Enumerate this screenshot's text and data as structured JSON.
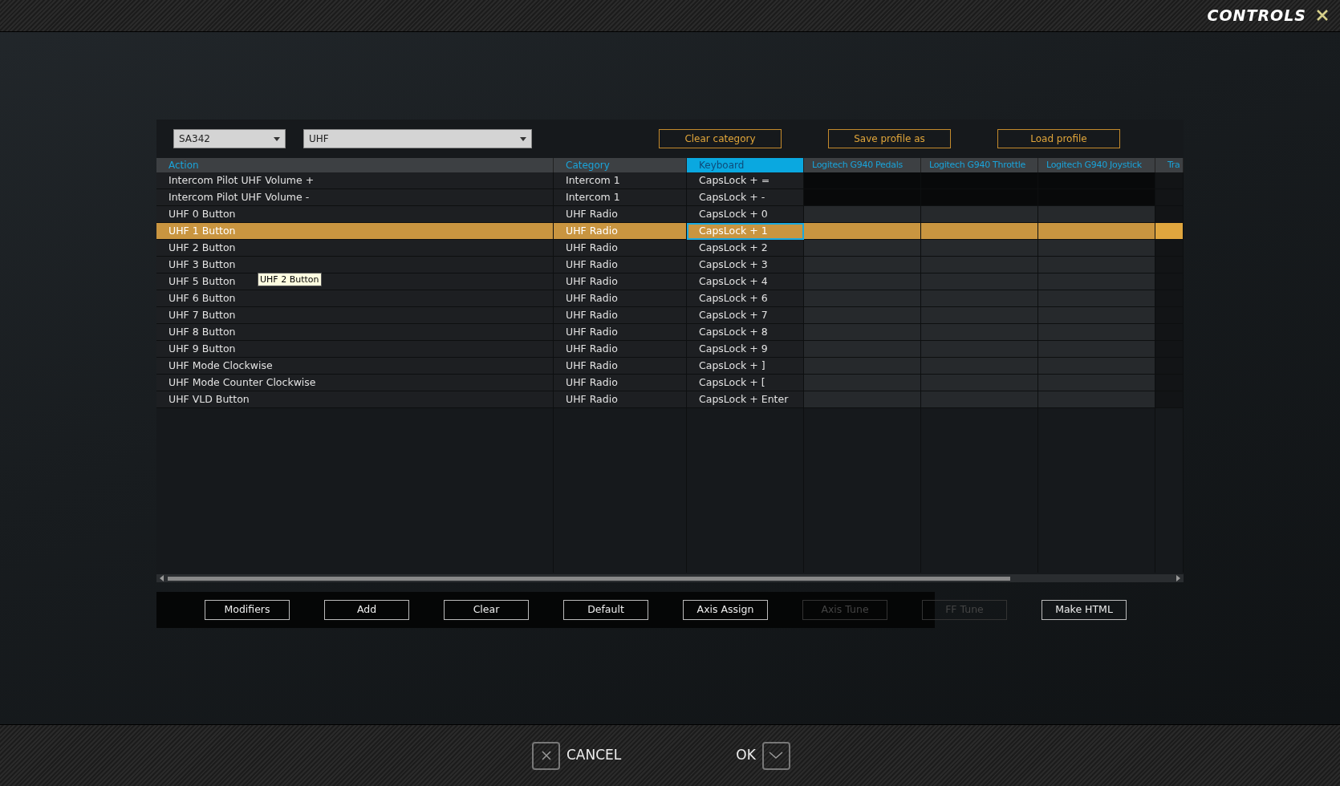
{
  "window": {
    "title": "CONTROLS"
  },
  "selectors": [
    {
      "value": "SA342"
    },
    {
      "value": "UHF"
    }
  ],
  "top_buttons": [
    "Clear category",
    "Save profile as",
    "Load profile"
  ],
  "table": {
    "columns": [
      {
        "label": "Action",
        "selected": false
      },
      {
        "label": "Category",
        "selected": false
      },
      {
        "label": "Keyboard",
        "selected": true
      },
      {
        "label": "Logitech G940 Pedals",
        "selected": false
      },
      {
        "label": "Logitech G940 Throttle",
        "selected": false
      },
      {
        "label": "Logitech G940 Joystick",
        "selected": false
      },
      {
        "label": "Tra",
        "selected": false
      }
    ],
    "rows": [
      {
        "action": "Intercom Pilot UHF Volume +",
        "category": "Intercom 1",
        "keyboard": "CapsLock + =",
        "selected": false,
        "devices_disabled": true
      },
      {
        "action": "Intercom Pilot UHF Volume -",
        "category": "Intercom 1",
        "keyboard": "CapsLock + -",
        "selected": false,
        "devices_disabled": true
      },
      {
        "action": "UHF 0 Button",
        "category": "UHF Radio",
        "keyboard": "CapsLock + 0",
        "selected": false,
        "devices_disabled": false
      },
      {
        "action": "UHF 1 Button",
        "category": "UHF Radio",
        "keyboard": "CapsLock + 1",
        "selected": true,
        "devices_disabled": false
      },
      {
        "action": "UHF 2 Button",
        "category": "UHF Radio",
        "keyboard": "CapsLock + 2",
        "selected": false,
        "devices_disabled": false
      },
      {
        "action": "UHF 3 Button",
        "category": "UHF Radio",
        "keyboard": "CapsLock + 3",
        "selected": false,
        "devices_disabled": false
      },
      {
        "action": "UHF 5 Button",
        "category": "UHF Radio",
        "keyboard": "CapsLock + 4",
        "selected": false,
        "devices_disabled": false
      },
      {
        "action": "UHF 6 Button",
        "category": "UHF Radio",
        "keyboard": "CapsLock + 6",
        "selected": false,
        "devices_disabled": false
      },
      {
        "action": "UHF 7 Button",
        "category": "UHF Radio",
        "keyboard": "CapsLock + 7",
        "selected": false,
        "devices_disabled": false
      },
      {
        "action": "UHF 8 Button",
        "category": "UHF Radio",
        "keyboard": "CapsLock + 8",
        "selected": false,
        "devices_disabled": false
      },
      {
        "action": "UHF 9 Button",
        "category": "UHF Radio",
        "keyboard": "CapsLock + 9",
        "selected": false,
        "devices_disabled": false
      },
      {
        "action": "UHF Mode Clockwise",
        "category": "UHF Radio",
        "keyboard": "CapsLock + ]",
        "selected": false,
        "devices_disabled": false
      },
      {
        "action": "UHF Mode Counter Clockwise",
        "category": "UHF Radio",
        "keyboard": "CapsLock + [",
        "selected": false,
        "devices_disabled": false
      },
      {
        "action": "UHF VLD Button",
        "category": "UHF Radio",
        "keyboard": "CapsLock + Enter",
        "selected": false,
        "devices_disabled": false
      }
    ]
  },
  "tooltip": {
    "text": "UHF 2 Button"
  },
  "bottom_buttons": [
    {
      "label": "Modifiers",
      "disabled": false
    },
    {
      "label": "Add",
      "disabled": false
    },
    {
      "label": "Clear",
      "disabled": false
    },
    {
      "label": "Default",
      "disabled": false
    },
    {
      "label": "Axis Assign",
      "disabled": false
    },
    {
      "label": "Axis Tune",
      "disabled": true
    },
    {
      "label": "FF Tune",
      "disabled": true
    },
    {
      "label": "Make HTML",
      "disabled": false
    }
  ],
  "footer": {
    "cancel": "CANCEL",
    "ok": "OK"
  }
}
